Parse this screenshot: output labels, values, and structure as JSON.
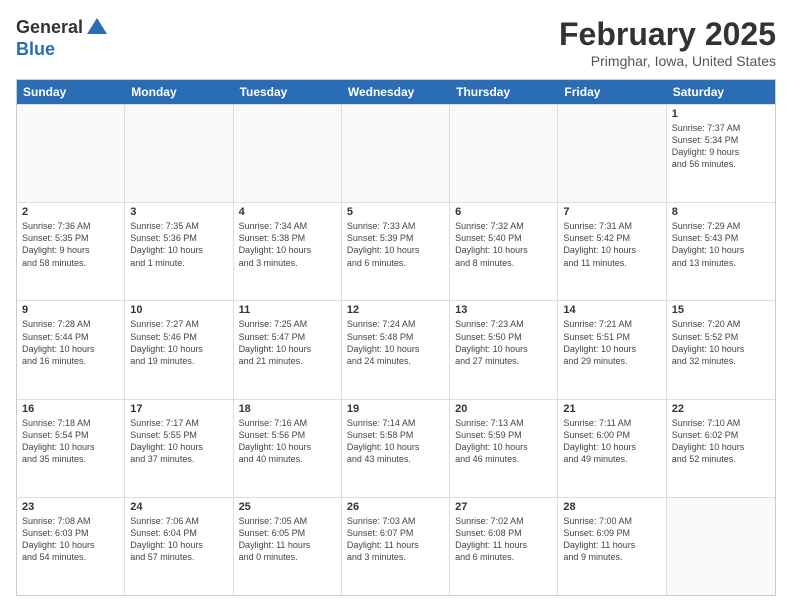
{
  "header": {
    "logo_general": "General",
    "logo_blue": "Blue",
    "title": "February 2025",
    "subtitle": "Primghar, Iowa, United States"
  },
  "days_of_week": [
    "Sunday",
    "Monday",
    "Tuesday",
    "Wednesday",
    "Thursday",
    "Friday",
    "Saturday"
  ],
  "rows": [
    [
      {
        "day": "",
        "empty": true
      },
      {
        "day": "",
        "empty": true
      },
      {
        "day": "",
        "empty": true
      },
      {
        "day": "",
        "empty": true
      },
      {
        "day": "",
        "empty": true
      },
      {
        "day": "",
        "empty": true
      },
      {
        "day": "1",
        "info": "Sunrise: 7:37 AM\nSunset: 5:34 PM\nDaylight: 9 hours\nand 56 minutes."
      }
    ],
    [
      {
        "day": "2",
        "info": "Sunrise: 7:36 AM\nSunset: 5:35 PM\nDaylight: 9 hours\nand 58 minutes."
      },
      {
        "day": "3",
        "info": "Sunrise: 7:35 AM\nSunset: 5:36 PM\nDaylight: 10 hours\nand 1 minute."
      },
      {
        "day": "4",
        "info": "Sunrise: 7:34 AM\nSunset: 5:38 PM\nDaylight: 10 hours\nand 3 minutes."
      },
      {
        "day": "5",
        "info": "Sunrise: 7:33 AM\nSunset: 5:39 PM\nDaylight: 10 hours\nand 6 minutes."
      },
      {
        "day": "6",
        "info": "Sunrise: 7:32 AM\nSunset: 5:40 PM\nDaylight: 10 hours\nand 8 minutes."
      },
      {
        "day": "7",
        "info": "Sunrise: 7:31 AM\nSunset: 5:42 PM\nDaylight: 10 hours\nand 11 minutes."
      },
      {
        "day": "8",
        "info": "Sunrise: 7:29 AM\nSunset: 5:43 PM\nDaylight: 10 hours\nand 13 minutes."
      }
    ],
    [
      {
        "day": "9",
        "info": "Sunrise: 7:28 AM\nSunset: 5:44 PM\nDaylight: 10 hours\nand 16 minutes."
      },
      {
        "day": "10",
        "info": "Sunrise: 7:27 AM\nSunset: 5:46 PM\nDaylight: 10 hours\nand 19 minutes."
      },
      {
        "day": "11",
        "info": "Sunrise: 7:25 AM\nSunset: 5:47 PM\nDaylight: 10 hours\nand 21 minutes."
      },
      {
        "day": "12",
        "info": "Sunrise: 7:24 AM\nSunset: 5:48 PM\nDaylight: 10 hours\nand 24 minutes."
      },
      {
        "day": "13",
        "info": "Sunrise: 7:23 AM\nSunset: 5:50 PM\nDaylight: 10 hours\nand 27 minutes."
      },
      {
        "day": "14",
        "info": "Sunrise: 7:21 AM\nSunset: 5:51 PM\nDaylight: 10 hours\nand 29 minutes."
      },
      {
        "day": "15",
        "info": "Sunrise: 7:20 AM\nSunset: 5:52 PM\nDaylight: 10 hours\nand 32 minutes."
      }
    ],
    [
      {
        "day": "16",
        "info": "Sunrise: 7:18 AM\nSunset: 5:54 PM\nDaylight: 10 hours\nand 35 minutes."
      },
      {
        "day": "17",
        "info": "Sunrise: 7:17 AM\nSunset: 5:55 PM\nDaylight: 10 hours\nand 37 minutes."
      },
      {
        "day": "18",
        "info": "Sunrise: 7:16 AM\nSunset: 5:56 PM\nDaylight: 10 hours\nand 40 minutes."
      },
      {
        "day": "19",
        "info": "Sunrise: 7:14 AM\nSunset: 5:58 PM\nDaylight: 10 hours\nand 43 minutes."
      },
      {
        "day": "20",
        "info": "Sunrise: 7:13 AM\nSunset: 5:59 PM\nDaylight: 10 hours\nand 46 minutes."
      },
      {
        "day": "21",
        "info": "Sunrise: 7:11 AM\nSunset: 6:00 PM\nDaylight: 10 hours\nand 49 minutes."
      },
      {
        "day": "22",
        "info": "Sunrise: 7:10 AM\nSunset: 6:02 PM\nDaylight: 10 hours\nand 52 minutes."
      }
    ],
    [
      {
        "day": "23",
        "info": "Sunrise: 7:08 AM\nSunset: 6:03 PM\nDaylight: 10 hours\nand 54 minutes."
      },
      {
        "day": "24",
        "info": "Sunrise: 7:06 AM\nSunset: 6:04 PM\nDaylight: 10 hours\nand 57 minutes."
      },
      {
        "day": "25",
        "info": "Sunrise: 7:05 AM\nSunset: 6:05 PM\nDaylight: 11 hours\nand 0 minutes."
      },
      {
        "day": "26",
        "info": "Sunrise: 7:03 AM\nSunset: 6:07 PM\nDaylight: 11 hours\nand 3 minutes."
      },
      {
        "day": "27",
        "info": "Sunrise: 7:02 AM\nSunset: 6:08 PM\nDaylight: 11 hours\nand 6 minutes."
      },
      {
        "day": "28",
        "info": "Sunrise: 7:00 AM\nSunset: 6:09 PM\nDaylight: 11 hours\nand 9 minutes."
      },
      {
        "day": "",
        "empty": true
      }
    ]
  ]
}
